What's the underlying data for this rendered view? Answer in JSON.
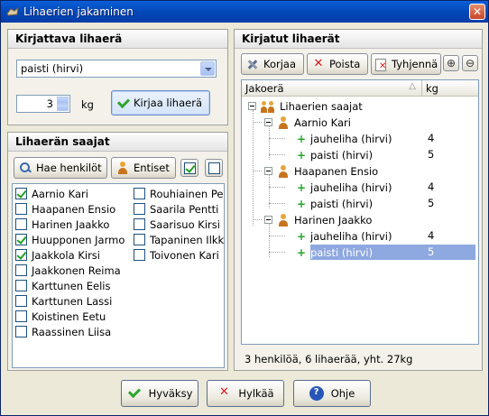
{
  "window": {
    "title": "Lihaerien jakaminen"
  },
  "left_top": {
    "header": "Kirjattava lihaerä",
    "select_value": "paisti (hirvi)",
    "quantity_value": "3",
    "unit": "kg",
    "record_button": "Kirjaa lihaerä"
  },
  "recipients": {
    "header": "Lihaerän saajat",
    "fetch_button": "Hae henkilöt",
    "previous_button": "Entiset",
    "col1": [
      {
        "name": "Aarnio Kari",
        "checked": true
      },
      {
        "name": "Haapanen Ensio",
        "checked": false
      },
      {
        "name": "Harinen Jaakko",
        "checked": false
      },
      {
        "name": "Huupponen Jarmo",
        "checked": true
      },
      {
        "name": "Jaakkola Kirsi",
        "checked": true
      },
      {
        "name": "Jaakkonen Reima",
        "checked": false
      },
      {
        "name": "Karttunen Eelis",
        "checked": false
      },
      {
        "name": "Karttunen Lassi",
        "checked": false
      },
      {
        "name": "Koistinen Eetu",
        "checked": false
      },
      {
        "name": "Raassinen Liisa",
        "checked": false
      }
    ],
    "col2": [
      {
        "name": "Rouhiainen Pek",
        "checked": false
      },
      {
        "name": "Saarila Pentti",
        "checked": false
      },
      {
        "name": "Saarisuo Kirsi",
        "checked": false
      },
      {
        "name": "Tapaninen Ilkk",
        "checked": false
      },
      {
        "name": "Toivonen Kari",
        "checked": false
      }
    ]
  },
  "recorded": {
    "header": "Kirjatut lihaerät",
    "fix_button": "Korjaa",
    "delete_button": "Poista",
    "clear_button": "Tyhjennä",
    "col_name": "Jakoerä",
    "col_kg": "kg",
    "root": "Lihaerien saajat",
    "people": [
      {
        "name": "Aarnio Kari",
        "items": [
          {
            "name": "jauheliha (hirvi)",
            "kg": "4"
          },
          {
            "name": "paisti (hirvi)",
            "kg": "5"
          }
        ]
      },
      {
        "name": "Haapanen Ensio",
        "items": [
          {
            "name": "jauheliha (hirvi)",
            "kg": "4"
          },
          {
            "name": "paisti (hirvi)",
            "kg": "5"
          }
        ]
      },
      {
        "name": "Harinen Jaakko",
        "items": [
          {
            "name": "jauheliha (hirvi)",
            "kg": "4"
          },
          {
            "name": "paisti (hirvi)",
            "kg": "5"
          }
        ]
      }
    ],
    "summary": "3 henkilöä, 6 lihaerää, yht. 27kg"
  },
  "footer": {
    "accept": "Hyväksy",
    "reject": "Hylkää",
    "help": "Ohje"
  }
}
